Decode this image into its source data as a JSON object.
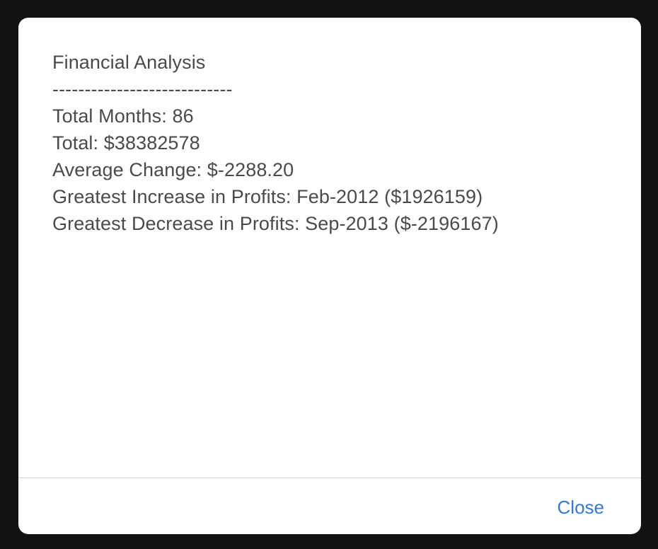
{
  "dialog": {
    "report_lines": [
      "Financial Analysis",
      "----------------------------",
      "Total Months: 86",
      "Total: $38382578",
      "Average Change: $-2288.20",
      "Greatest Increase in Profits: Feb-2012 ($1926159)",
      "Greatest Decrease in Profits: Sep-2013 ($-2196167)"
    ],
    "close_label": "Close"
  },
  "colors": {
    "backdrop": "#121212",
    "dialog_background": "#ffffff",
    "text": "#4a4a4a",
    "accent": "#3478d8",
    "divider": "#d6d6d6"
  }
}
